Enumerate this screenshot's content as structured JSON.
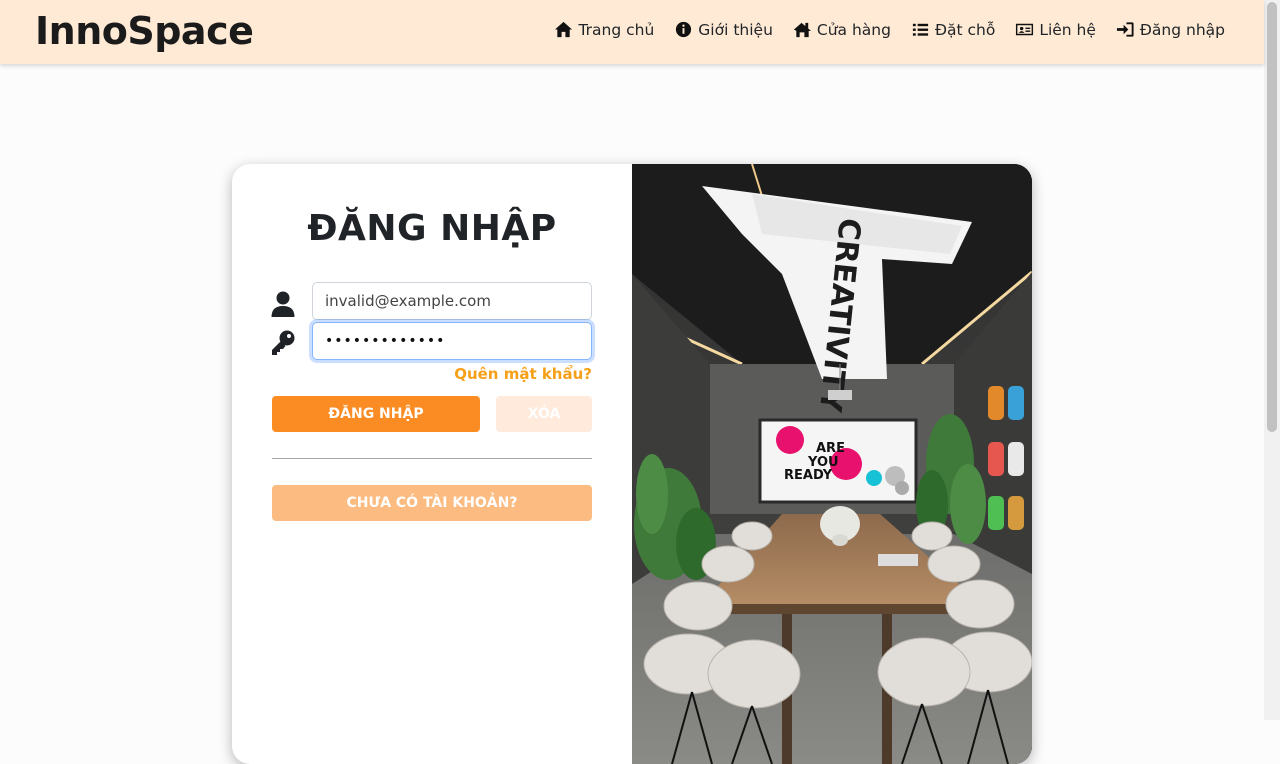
{
  "brand": "InnoSpace",
  "nav": [
    {
      "label": "Trang chủ",
      "icon": "home-icon"
    },
    {
      "label": "Giới thiệu",
      "icon": "info-circle-icon"
    },
    {
      "label": "Cửa hàng",
      "icon": "store-icon"
    },
    {
      "label": "Đặt chỗ",
      "icon": "list-icon"
    },
    {
      "label": "Liên hệ",
      "icon": "contact-card-icon"
    },
    {
      "label": "Đăng nhập",
      "icon": "sign-in-icon"
    }
  ],
  "login": {
    "title": "ĐĂNG NHẬP",
    "email_value": "invalid@example.com",
    "password_masked": "•••••••••••••",
    "forgot_label": "Quên mật khẩu?",
    "login_button": "ĐĂNG NHẬP",
    "clear_button": "XÓA",
    "register_button": "CHƯA CÓ TÀI KHOẢN?"
  },
  "photo": {
    "sign_text": "CREATIVITY",
    "screen_text": [
      "ARE",
      "YOU",
      "READY"
    ]
  },
  "colors": {
    "navbar_bg": "#ffead5",
    "primary_orange": "#fb8c24",
    "forgot_link": "#f6a01a",
    "register_bg": "#fcbb80",
    "clear_bg": "#ffeadb"
  }
}
